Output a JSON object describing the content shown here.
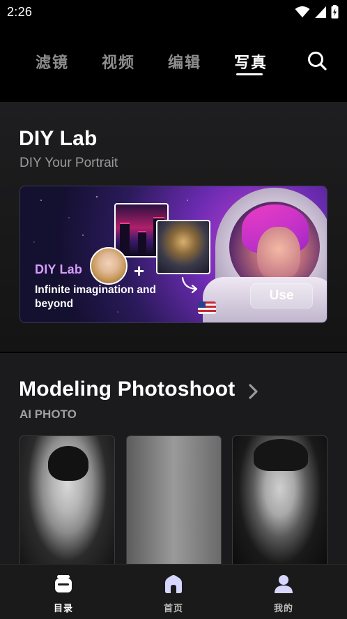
{
  "status_bar": {
    "time": "2:26"
  },
  "top_tabs": [
    {
      "label": "滤镜",
      "active": false
    },
    {
      "label": "视频",
      "active": false
    },
    {
      "label": "编辑",
      "active": false
    },
    {
      "label": "写真",
      "active": true
    }
  ],
  "diy_section": {
    "title": "DIY Lab",
    "subtitle": "DIY Your Portrait",
    "banner": {
      "brand": "DIY Lab",
      "tagline": "Infinite imagination and beyond",
      "cta": "Use"
    }
  },
  "modeling_section": {
    "title": "Modeling Photoshoot",
    "subtitle": "AI PHOTO"
  },
  "bottom_nav": [
    {
      "label": "目录",
      "icon": "catalog-icon",
      "active": true
    },
    {
      "label": "首页",
      "icon": "home-icon",
      "active": false
    },
    {
      "label": "我的",
      "icon": "profile-icon",
      "active": false
    }
  ],
  "colors": {
    "background": "#000000",
    "section_bg": "#1c1c1e",
    "inactive_tab": "#8e8e8e",
    "brand_purple": "#d79cff",
    "nav_icon_inactive": "#d6d6ff"
  }
}
